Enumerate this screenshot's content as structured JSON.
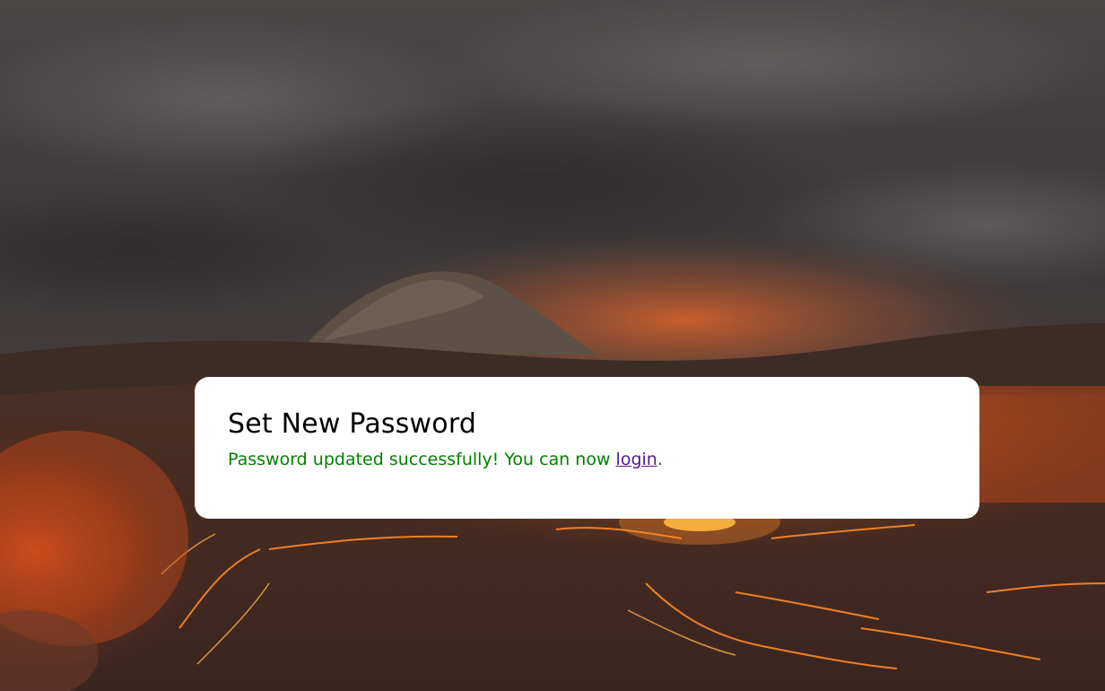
{
  "background": {
    "image_description_icon": "volcanic-lava-landscape",
    "sky_color": "#3b3839",
    "horizon_glow_color": "#e0652c",
    "lava_color": "#ff7a1a"
  },
  "card": {
    "title": "Set New Password",
    "message_prefix": "Password updated successfully! You can now ",
    "login_link_label": "login",
    "message_suffix": ".",
    "colors": {
      "title": "#000000",
      "message": "#008000",
      "link": "#551a8b",
      "background": "#ffffff"
    }
  }
}
